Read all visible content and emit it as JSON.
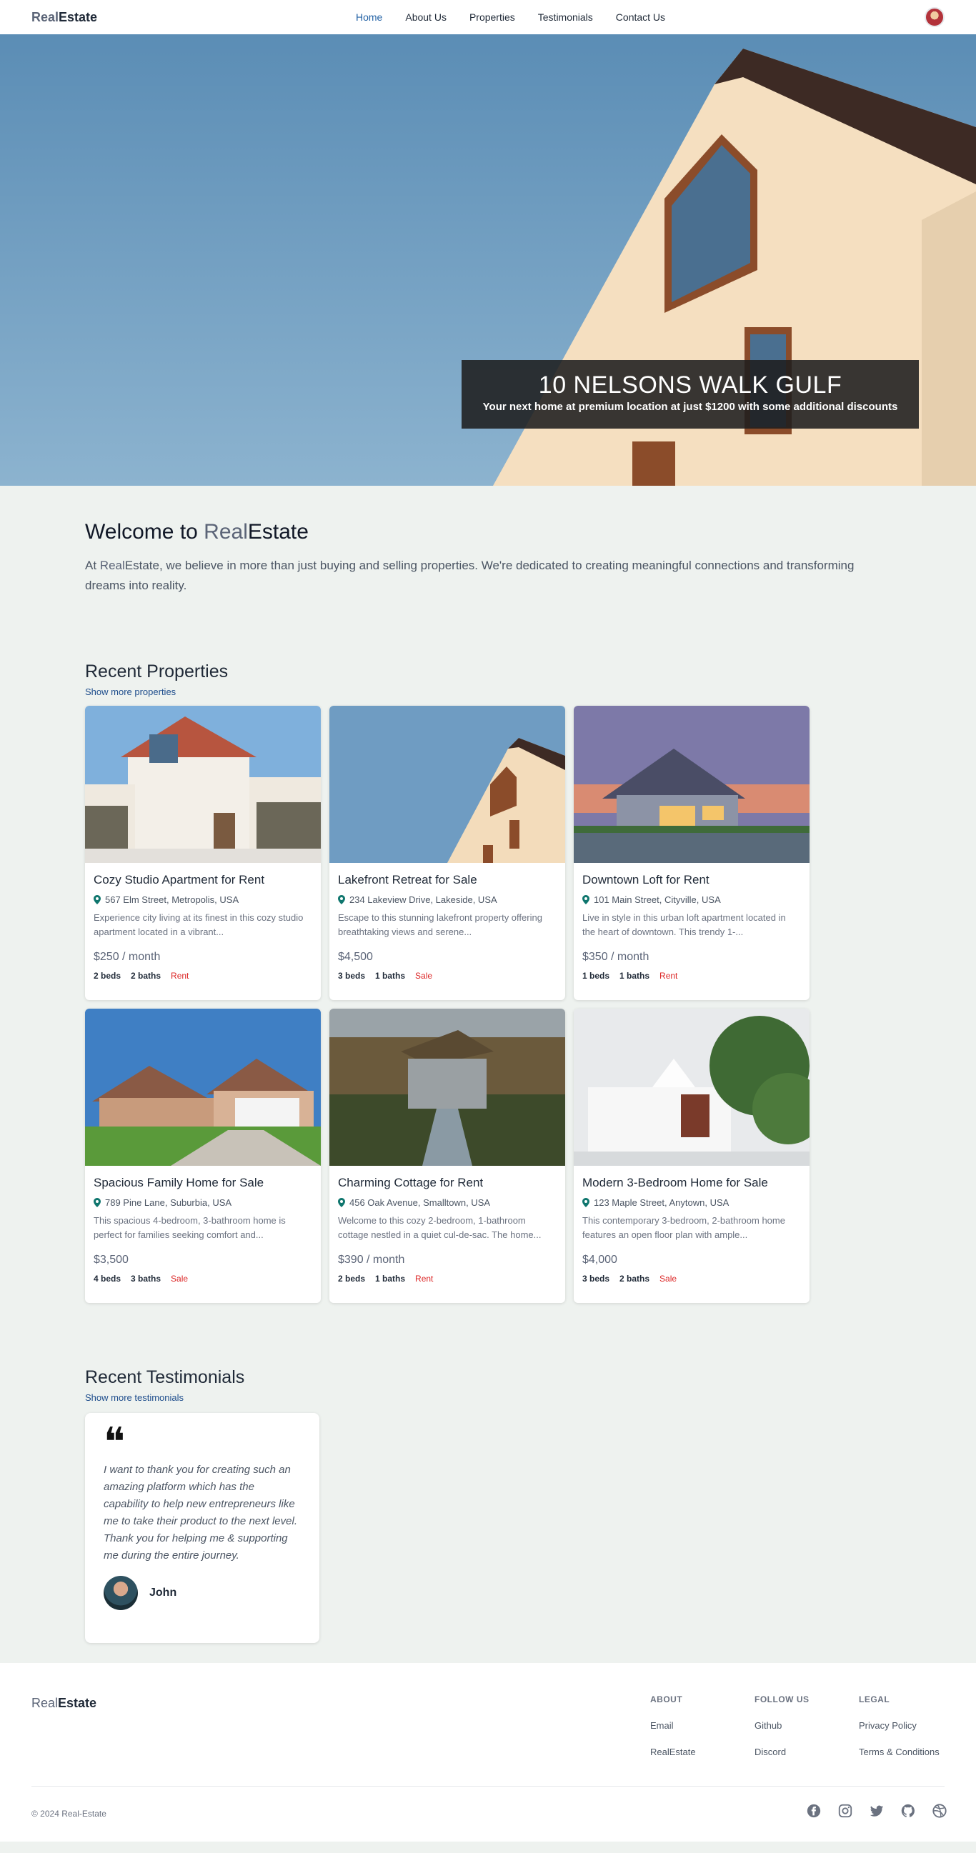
{
  "nav": {
    "brand_prefix": "Real",
    "brand_suffix": "Estate",
    "links": [
      "Home",
      "About Us",
      "Properties",
      "Testimonials",
      "Contact Us"
    ]
  },
  "hero": {
    "title": "10 NELSONS WALK GULF",
    "subtitle": "Your next home at premium location at just $1200 with some additional discounts"
  },
  "welcome": {
    "title_prefix": "Welcome to ",
    "brand_prefix": "Real",
    "brand_suffix": "Estate",
    "text_prefix": "At ",
    "text_rest": ", we believe in more than just buying and selling properties. We're dedicated to creating meaningful connections and transforming dreams into reality."
  },
  "recent_properties": {
    "title": "Recent Properties",
    "show_more": "Show more properties",
    "items": [
      {
        "title": "Cozy Studio Apartment for Rent",
        "address": "567 Elm Street, Metropolis, USA",
        "description": "Experience city living at its finest in this cozy studio apartment located in a vibrant...",
        "price": "$250 / month",
        "beds": "2 beds",
        "baths": "2 baths",
        "kind": "Rent"
      },
      {
        "title": "Lakefront Retreat for Sale",
        "address": "234 Lakeview Drive, Lakeside, USA",
        "description": "Escape to this stunning lakefront property offering breathtaking views and serene...",
        "price": "$4,500",
        "beds": "3 beds",
        "baths": "1 baths",
        "kind": "Sale"
      },
      {
        "title": "Downtown Loft for Rent",
        "address": "101 Main Street, Cityville, USA",
        "description": "Live in style in this urban loft apartment located in the heart of downtown. This trendy 1-...",
        "price": "$350 / month",
        "beds": "1 beds",
        "baths": "1 baths",
        "kind": "Rent"
      },
      {
        "title": "Spacious Family Home for Sale",
        "address": "789 Pine Lane, Suburbia, USA",
        "description": "This spacious 4-bedroom, 3-bathroom home is perfect for families seeking comfort and...",
        "price": "$3,500",
        "beds": "4 beds",
        "baths": "3 baths",
        "kind": "Sale"
      },
      {
        "title": "Charming Cottage for Rent",
        "address": "456 Oak Avenue, Smalltown, USA",
        "description": "Welcome to this cozy 2-bedroom, 1-bathroom cottage nestled in a quiet cul-de-sac. The home...",
        "price": "$390 / month",
        "beds": "2 beds",
        "baths": "1 baths",
        "kind": "Rent"
      },
      {
        "title": "Modern 3-Bedroom Home for Sale",
        "address": "123 Maple Street, Anytown, USA",
        "description": "This contemporary 3-bedroom, 2-bathroom home features an open floor plan with ample...",
        "price": "$4,000",
        "beds": "3 beds",
        "baths": "2 baths",
        "kind": "Sale"
      }
    ]
  },
  "recent_testimonials": {
    "title": "Recent Testimonials",
    "show_more": "Show more testimonials",
    "quote_mark": "❝",
    "items": [
      {
        "text": "I want to thank you for creating such an amazing platform which has the capability to help new entrepreneurs like me to take their product to the next level. Thank you for helping me & supporting me during the entire journey.",
        "author": "John"
      }
    ]
  },
  "footer": {
    "brand_prefix": "Real",
    "brand_suffix": "Estate",
    "columns": [
      {
        "title": "ABOUT",
        "links": [
          "Email",
          "RealEstate"
        ]
      },
      {
        "title": "FOLLOW US",
        "links": [
          "Github",
          "Discord"
        ]
      },
      {
        "title": "LEGAL",
        "links": [
          "Privacy Policy",
          "Terms & Conditions"
        ]
      }
    ],
    "copyright": "© 2024 Real-Estate",
    "social_icons": [
      "facebook-icon",
      "instagram-icon",
      "twitter-icon",
      "github-icon",
      "dribbble-icon"
    ]
  },
  "colors": {
    "page_bg": "#eef2ef",
    "accent": "#5b6477",
    "link": "#1e4d8c",
    "active_nav": "#2563a6",
    "tag_red": "#dc2626",
    "pin_green": "#0f766e"
  }
}
